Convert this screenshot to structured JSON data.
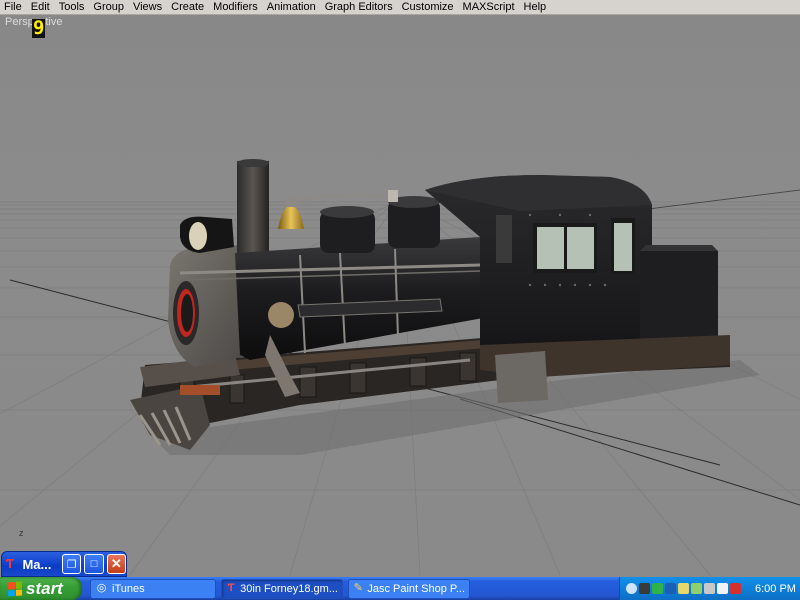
{
  "menu": [
    "File",
    "Edit",
    "Tools",
    "Group",
    "Views",
    "Create",
    "Modifiers",
    "Animation",
    "Graph Editors",
    "Customize",
    "MAXScript",
    "Help"
  ],
  "viewport": {
    "label": "Perspective",
    "counter": "9",
    "axis_label": "z"
  },
  "minimized_window": {
    "title": "Ma...",
    "icon": "3ds-max-icon",
    "buttons": [
      "restore-icon",
      "maximize-icon",
      "close-icon"
    ]
  },
  "taskbar": {
    "start_label": "start",
    "tasks": [
      {
        "label": "iTunes",
        "icon": "itunes-icon",
        "active": false
      },
      {
        "label": "30in Forney18.gm...",
        "icon": "3ds-max-icon",
        "active": true
      },
      {
        "label": "Jasc Paint Shop P...",
        "icon": "paint-shop-icon",
        "active": false
      }
    ],
    "clock": "6:00 PM"
  },
  "colors": {
    "viewport_bg": "#8a8a8a",
    "grid_line": "#7a7a7a",
    "locomotive_body": "#1c1c1e",
    "taskbar_blue": "#245edc",
    "start_green": "#3aa33a",
    "tray_blue": "#0f7fd8"
  }
}
